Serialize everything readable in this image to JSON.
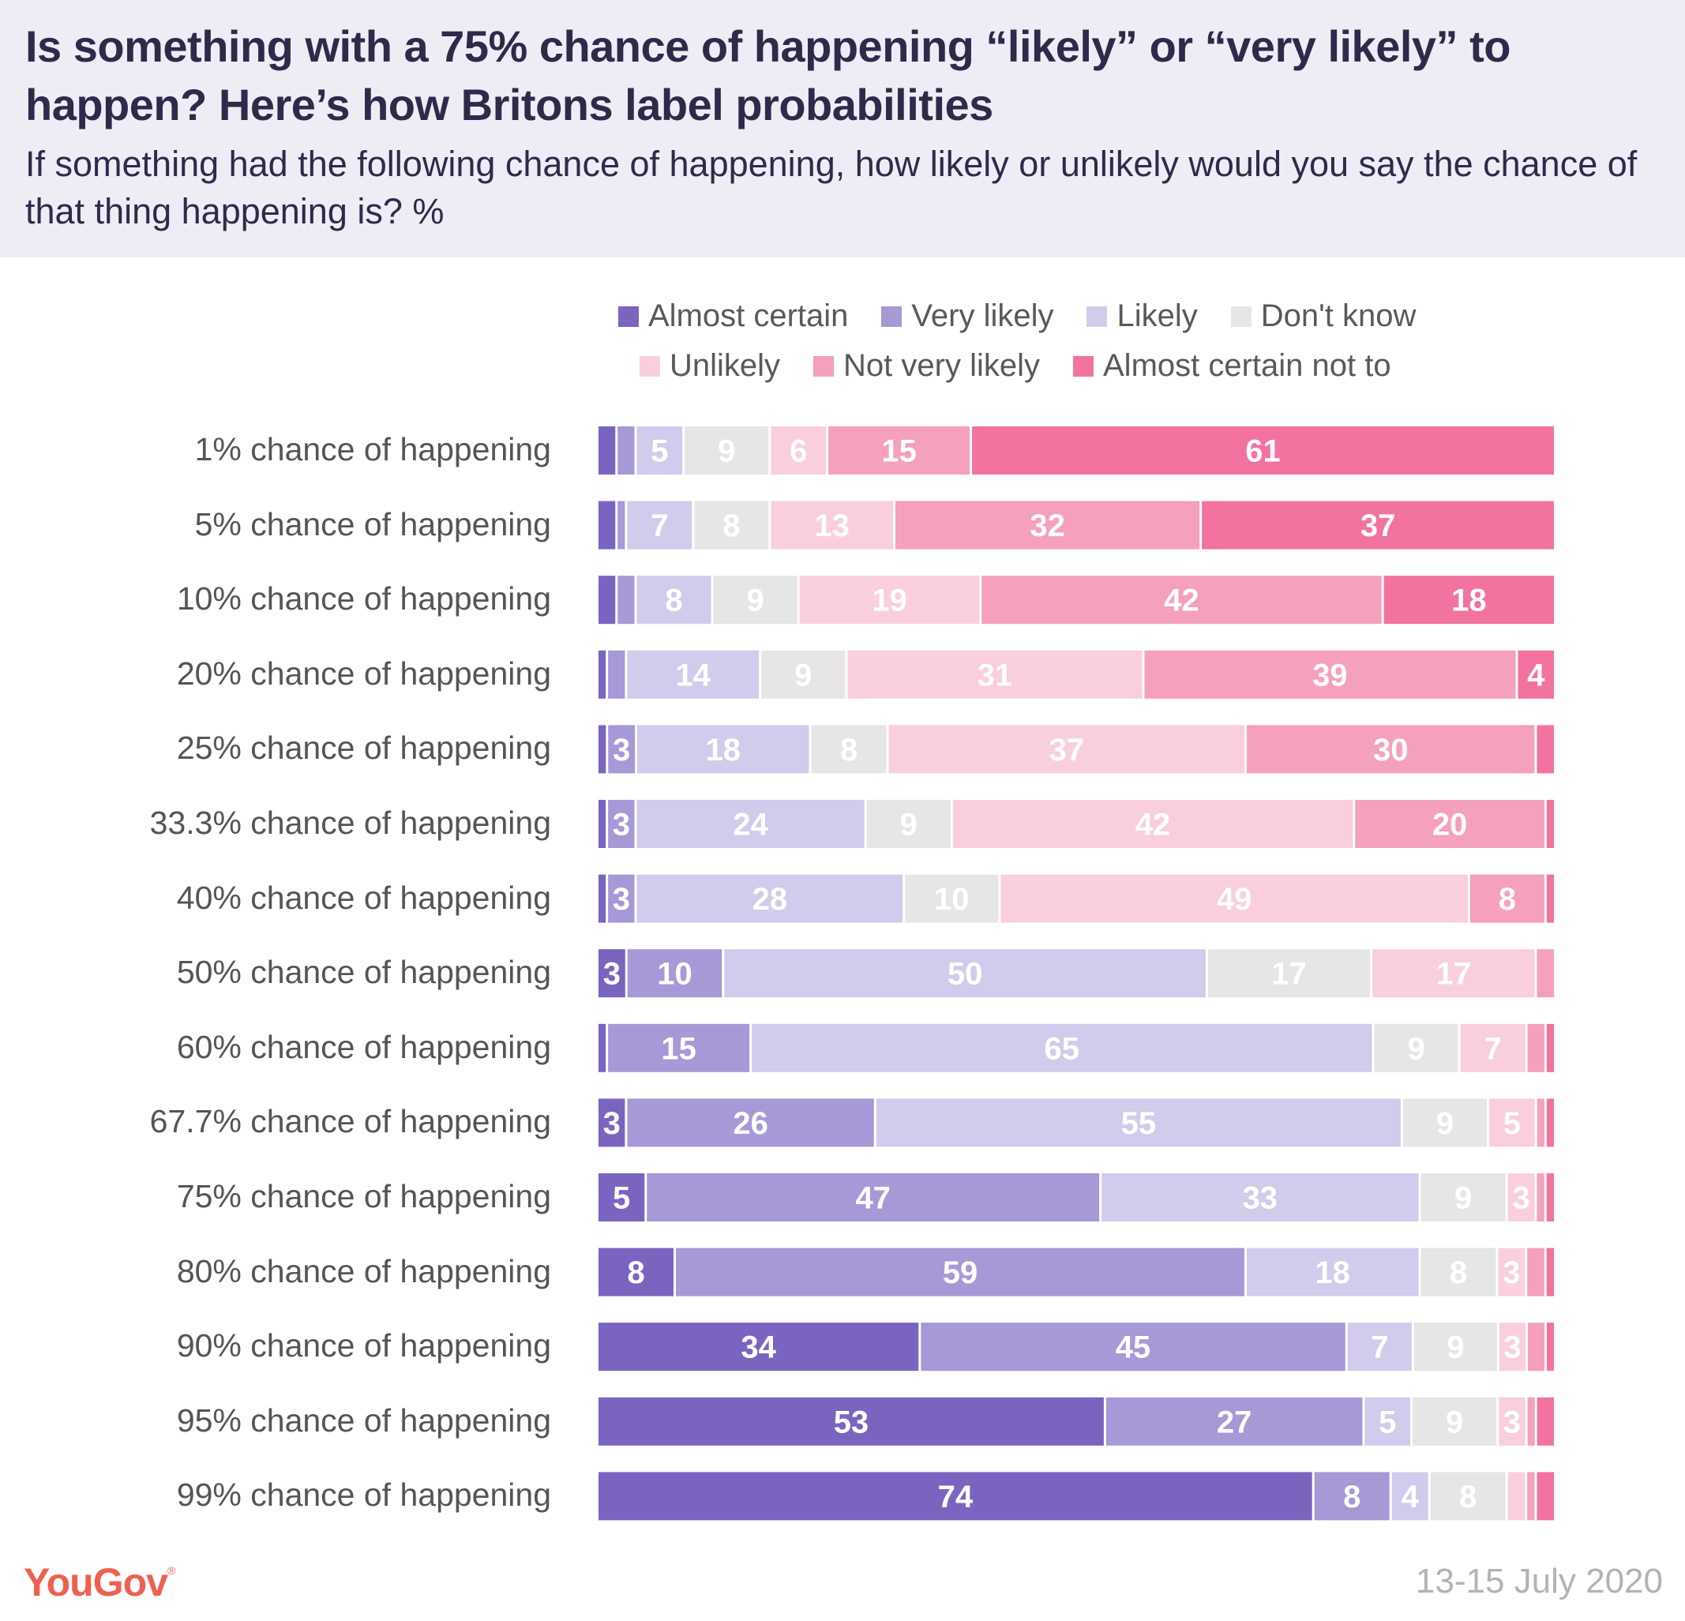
{
  "header": {
    "title": "Is something with a 75% chance of happening “likely” or “very likely” to happen? Here’s how Britons label probabilities",
    "subtitle": "If something had the following chance of happening, how likely or unlikely would you say the chance of that thing happening is? %"
  },
  "footer": {
    "logo": "YouGov",
    "logo_mark": "®",
    "date": "13-15 July 2020"
  },
  "chart_data": {
    "type": "bar",
    "orientation": "horizontal",
    "stacked": true,
    "title": "Is something with a 75% chance of happening “likely” or “very likely” to happen? Here’s how Britons label probabilities",
    "subtitle": "If something had the following chance of happening, how likely or unlikely would you say the chance of that thing happening is? %",
    "xlabel": "",
    "ylabel": "",
    "xlim": [
      0,
      100
    ],
    "grid": false,
    "legend_position": "top-right",
    "categories": [
      "1% chance of happening",
      "5% chance of happening",
      "10% chance of happening",
      "20% chance of happening",
      "25% chance of happening",
      "33.3% chance of happening",
      "40% chance of happening",
      "50% chance of happening",
      "60% chance of happening",
      "67.7% chance of happening",
      "75% chance of happening",
      "80% chance of happening",
      "90% chance of happening",
      "95% chance of happening",
      "99% chance of happening"
    ],
    "series": [
      {
        "name": "Almost certain",
        "color": "#7b64c0",
        "values": [
          2,
          2,
          2,
          1,
          1,
          1,
          1,
          3,
          1,
          3,
          5,
          8,
          34,
          53,
          74
        ],
        "labels": [
          "",
          "",
          "",
          "",
          "",
          "",
          "",
          "3",
          "",
          "3",
          "5",
          "8",
          "34",
          "53",
          "74"
        ]
      },
      {
        "name": "Very likely",
        "color": "#a798d6",
        "values": [
          2,
          1,
          2,
          2,
          3,
          3,
          3,
          10,
          15,
          26,
          47,
          59,
          45,
          27,
          8
        ],
        "labels": [
          "",
          "",
          "",
          "",
          "3",
          "3",
          "3",
          "10",
          "15",
          "26",
          "47",
          "59",
          "45",
          "27",
          "8"
        ]
      },
      {
        "name": "Likely",
        "color": "#d3cbeb",
        "values": [
          5,
          7,
          8,
          14,
          18,
          24,
          28,
          50,
          65,
          55,
          33,
          18,
          7,
          5,
          4
        ],
        "labels": [
          "5",
          "7",
          "8",
          "14",
          "18",
          "24",
          "28",
          "50",
          "65",
          "55",
          "33",
          "18",
          "7",
          "5",
          "4"
        ]
      },
      {
        "name": "Don't know",
        "color": "#e6e6e6",
        "values": [
          9,
          8,
          9,
          9,
          8,
          9,
          10,
          17,
          9,
          9,
          9,
          8,
          9,
          9,
          8
        ],
        "labels": [
          "9",
          "8",
          "9",
          "9",
          "8",
          "9",
          "10",
          "17",
          "9",
          "9",
          "9",
          "8",
          "9",
          "9",
          "8"
        ]
      },
      {
        "name": "Unlikely",
        "color": "#f9cfde",
        "values": [
          6,
          13,
          19,
          31,
          37,
          42,
          49,
          17,
          7,
          5,
          3,
          3,
          3,
          3,
          2
        ],
        "labels": [
          "6",
          "13",
          "19",
          "31",
          "37",
          "42",
          "49",
          "17",
          "7",
          "5",
          "3",
          "3",
          "3",
          "3",
          ""
        ]
      },
      {
        "name": "Not very likely",
        "color": "#f5a0bd",
        "values": [
          15,
          32,
          42,
          39,
          30,
          20,
          8,
          2,
          2,
          1,
          1,
          2,
          2,
          1,
          1
        ],
        "labels": [
          "15",
          "32",
          "42",
          "39",
          "30",
          "20",
          "8",
          "",
          "",
          "",
          "",
          "",
          "",
          "",
          ""
        ]
      },
      {
        "name": "Almost certain not to",
        "color": "#f272a0",
        "values": [
          61,
          37,
          18,
          4,
          2,
          1,
          1,
          0,
          1,
          1,
          1,
          1,
          1,
          2,
          2
        ],
        "labels": [
          "61",
          "37",
          "18",
          "4",
          "",
          "",
          "",
          "",
          "",
          "",
          "",
          "",
          "",
          "",
          ""
        ]
      }
    ]
  }
}
